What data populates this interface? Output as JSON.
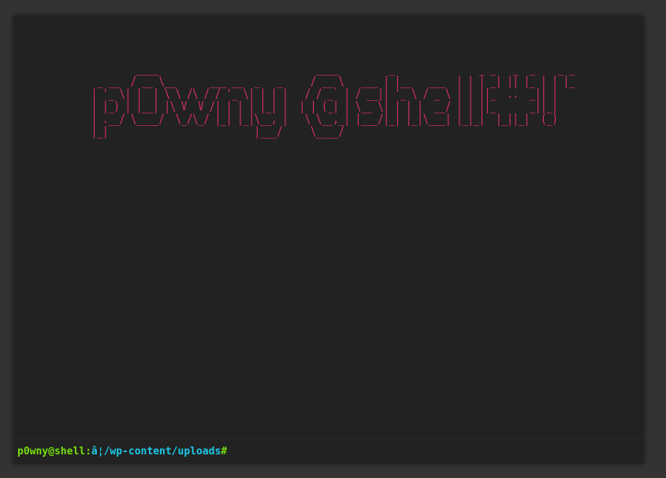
{
  "banner": {
    "ascii_art": "        ____                            ____         _               _ _   _  _    _ _\n _ __  / __ \\__      ___ __  _   _     / __ \\   ___ | |__   ___  | | | _| || |_ | | |_\n| '_ \\| |  | \\ \\ /\\ / / '_ \\| | | |   / / _` | / __|| '_ \\ / _ \\ | | ||_  ..  _|| |\n| |_) | |__| |\\ V  V /| | | | |_| |  | | (_| | \\__ \\| | | |  __/ | | ||_      _||_|\n| .__/ \\____/  \\_/\\_/ |_| |_|\\__, |   \\ \\__,_| |___/|_| |_|\\___| |_|_|  |_||_|  (_)\n|_|                          |___/     \\____/",
    "color": "#e8306a"
  },
  "prompt": {
    "user_host": "p0wny@shell",
    "separator": ":",
    "cwd": "â¦/wp-content/uploads",
    "symbol": "#",
    "input_value": ""
  },
  "colors": {
    "page_background": "#333333",
    "shell_background": "#222222",
    "prompt_user": "#75df0b",
    "prompt_cwd": "#1bc9e7"
  }
}
